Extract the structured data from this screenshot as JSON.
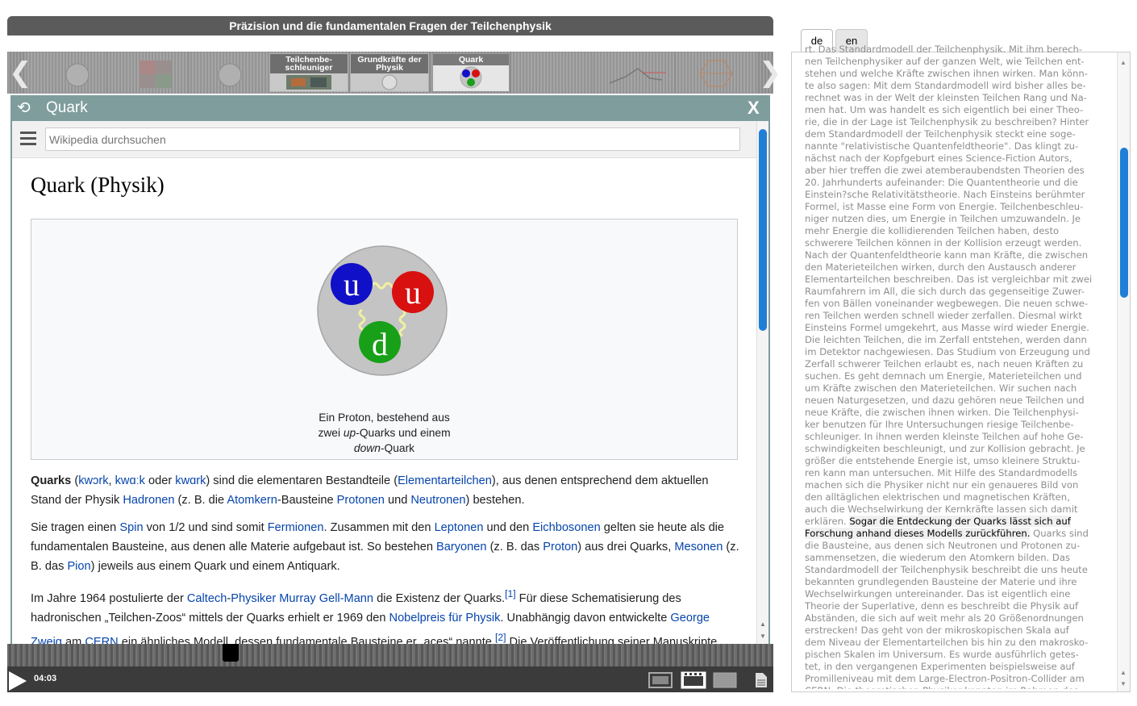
{
  "video": {
    "title": "Präzision und die fundamentalen Fragen der Teilchenphysik",
    "chapters": [
      {
        "label": "Teilchenbe-schleuniger"
      },
      {
        "label": "Grundkräfte der Physik"
      },
      {
        "label": "Quark"
      }
    ],
    "time": "04:03"
  },
  "overlay": {
    "title": "Quark",
    "close_label": "X"
  },
  "wiki": {
    "search_placeholder": "Wikipedia durchsuchen",
    "heading": "Quark (Physik)",
    "figure": {
      "quarks": [
        "u",
        "u",
        "d"
      ],
      "caption_l1": "Ein Proton, bestehend aus",
      "caption_l2_pre": "zwei ",
      "caption_l2_em": "up",
      "caption_l2_post": "-Quarks und einem",
      "caption_l3_em": "down",
      "caption_l3_post": "-Quark"
    },
    "p1": {
      "t0": "Quarks",
      "t1": " (",
      "l1": "kwɔrk",
      "t2": ", ",
      "l2": "kwɑːk",
      "t3": " oder ",
      "l3": "kwɑrk",
      "t4": ") sind die elementaren Bestandteile (",
      "l4": "Elementarteilchen",
      "t5": "), aus denen entsprechend dem aktuellen Stand der Physik ",
      "l5": "Hadronen",
      "t6": " (z. B. die ",
      "l6": "Atomkern",
      "t7": "-Bausteine ",
      "l7": "Protonen",
      "t8": " und ",
      "l8": "Neutronen",
      "t9": ") bestehen."
    },
    "p2": {
      "t0": "Sie tragen einen ",
      "l1": "Spin",
      "t1": " von 1/2 und sind somit ",
      "l2": "Fermionen",
      "t2": ". Zusammen mit den ",
      "l3": "Leptonen",
      "t3": " und den ",
      "l4": "Eichbosonen",
      "t4": " gelten sie heute als die fundamentalen Bausteine, aus denen alle Materie aufgebaut ist. So bestehen ",
      "l5": "Baryonen",
      "t5": " (z. B. das ",
      "l6": "Proton",
      "t6": ") aus drei Quarks, ",
      "l7": "Mesonen",
      "t7": " (z. B. das ",
      "l8": "Pion",
      "t8": ") jeweils aus einem Quark und einem Antiquark."
    },
    "p3": {
      "t0": "Im Jahre 1964 postulierte der ",
      "l1": "Caltech",
      "t1": "-",
      "l2": "Physiker Murray Gell-Mann",
      "t2": " die Existenz der Quarks.",
      "r1": "[1]",
      "t3": " Für diese Schematisierung des hadronischen „Teilchen-Zoos“ mittels der Quarks erhielt er 1969 den ",
      "l3": "Nobelpreis für Physik",
      "t4": ". Unabhängig davon entwickelte ",
      "l4": "George Zweig",
      "t5": " am ",
      "l5": "CERN",
      "t6": " ein ähnliches Modell, dessen fundamentale Bausteine er „aces“ nannte.",
      "r2": "[2]",
      "t7": " Die Veröffentlichung seiner Manuskripte"
    }
  },
  "transcript": {
    "tabs": [
      {
        "label": "de"
      },
      {
        "label": "en"
      }
    ],
    "before": "rt. Das Standardmodell der Teilchenphysik. Mit ihm berech-\nnen Teilchenphysiker auf der ganzen Welt, wie Teilchen ent-\nstehen und welche Kräfte zwischen ihnen wirken. Man könn-\nte also sagen: Mit dem Standardmodell wird bisher alles be-\nrechnet was in der Welt der kleinsten Teilchen Rang und Na-\nmen hat. Um was handelt es sich eigentlich bei einer Theo-\nrie, die in der Lage ist Teilchenphysik zu beschreiben? Hinter\ndem Standardmodell der Teilchenphysik steckt eine soge-\nnannte \"relativistische Quantenfeldtheorie\". Das klingt zu-\nnächst nach der Kopfgeburt eines Science-Fiction Autors,\naber hier treffen die zwei atemberaubendsten Theorien des\n20. Jahrhunderts aufeinander: Die Quantentheorie und die\nEinstein?sche Relativitätstheorie. Nach Einsteins berühmter\nFormel, ist Masse eine Form von Energie. Teilchenbeschleu-\nniger nutzen dies, um Energie in Teilchen umzuwandeln. Je\nmehr Energie die kollidierenden Teilchen haben, desto\nschwerere Teilchen können in der Kollision erzeugt werden.\nNach der Quantenfeldtheorie kann man Kräfte, die zwischen\nden Materieteilchen wirken, durch den Austausch anderer\nElementarteilchen beschreiben. Das ist vergleichbar mit zwei\nRaumfahrern im All, die sich durch das gegenseitige Zuwer-\nfen von Bällen voneinander wegbewegen. Die neuen schwe-\nren Teilchen werden schnell wieder zerfallen. Diesmal wirkt\nEinsteins Formel umgekehrt, aus Masse wird wieder Energie.\nDie leichten Teilchen, die im Zerfall entstehen, werden dann\nim Detektor nachgewiesen. Das Studium von Erzeugung und\nZerfall schwerer Teilchen erlaubt es, nach neuen Kräften zu\nsuchen. Es geht demnach um Energie, Materieteilchen und\num Kräfte zwischen den Materieteilchen. Wir suchen nach\nneuen Naturgesetzen, und dazu gehören neue Teilchen und\nneue Kräfte, die zwischen ihnen wirken. Die Teilchenphysi-\nker benutzen für Ihre Untersuchungen riesige Teilchenbe-\nschleuniger. In ihnen werden kleinste Teilchen auf hohe Ge-\nschwindigkeiten beschleunigt, und zur Kollision gebracht. Je\ngrößer die entstehende Energie ist, umso kleinere Struktu-\nren kann man untersuchen. Mit Hilfe des Standardmodells\nmachen sich die Physiker nicht nur ein genaueres Bild von\nden alltäglichen elektrischen und magnetischen Kräften,\nauch die Wechselwirkung der Kernkräfte lassen sich damit\nerklären. ",
    "highlight": "Sogar die Entdeckung der Quarks lässt sich auf\nForschung anhand dieses Modells zurückführen.",
    "after": " Quarks sind\ndie Bausteine, aus denen sich Neutronen und Protonen zu-\nsammensetzen, die wiederum den Atomkern bilden. Das\nStandardmodell der Teilchenphysik beschreibt die uns heute\nbekannten grundlegenden Bausteine der Materie und ihre\nWechselwirkungen untereinander. Das ist eigentlich eine\nTheorie der Superlative, denn es beschreibt die Physik auf\nAbständen, die sich auf weit mehr als 20 Größenordnungen\nerstrecken! Das geht von der mikroskopischen Skala auf\ndem Niveau der Elementarteilchen bis hin zu den makrosko-\npischen Skalen im Universum. Es wurde ausführlich getes-\ntet, in den vergangenen Experimenten beispielsweise auf\nPromilleniveau mit dem Large-Electron-Positron-Collider am\nCERN. Die theoretischen Physiker konnten im Rahmen des"
  },
  "colors": {
    "accent": "#1f7fd6",
    "link": "#0645ad",
    "overlay": "#7e9c9c",
    "titlebar": "#5b5b5b",
    "quark_up": "#1010c8",
    "quark_up2": "#d81010",
    "quark_down": "#18a018"
  }
}
